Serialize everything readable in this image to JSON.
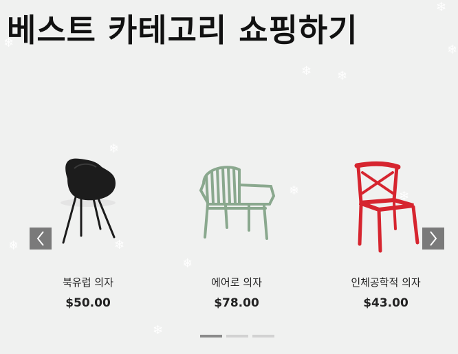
{
  "section": {
    "title": "베스트 카테고리 쇼핑하기"
  },
  "carousel": {
    "prev_icon": "chevron-left-icon",
    "next_icon": "chevron-right-icon",
    "products": [
      {
        "name": "북유럽 의자",
        "price": "$50.00",
        "color": "#1c1c1c",
        "style": "black-shell-chair"
      },
      {
        "name": "에어로 의자",
        "price": "$78.00",
        "color": "#8aa88e",
        "style": "green-slatted-armchair"
      },
      {
        "name": "인체공학적 의자",
        "price": "$43.00",
        "color": "#d6252f",
        "style": "red-cross-back-chair"
      }
    ],
    "pagination": {
      "count": 3,
      "active": 1
    }
  },
  "theme": {
    "background": "#f0f1f0",
    "arrow_bg": "#7a7a7a",
    "dot_active": "#8a8a8a",
    "dot_inactive": "#d2d2d2"
  }
}
